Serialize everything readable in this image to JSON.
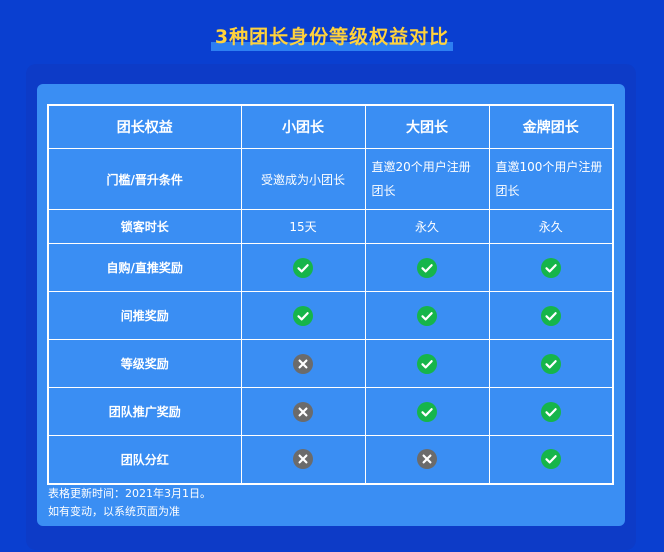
{
  "title": "3种团长身份等级权益对比",
  "headers": [
    "团长权益",
    "小团长",
    "大团长",
    "金牌团长"
  ],
  "rows": [
    {
      "label": "门槛/晋升条件",
      "cells": [
        "受邀成为小团长",
        "直邀20个用户注册团长",
        "直邀100个用户注册团长"
      ]
    },
    {
      "label": "锁客时长",
      "cells": [
        "15天",
        "永久",
        "永久"
      ]
    },
    {
      "label": "自购/直推奖励",
      "icons": [
        "check",
        "check",
        "check"
      ]
    },
    {
      "label": "间推奖励",
      "icons": [
        "check",
        "check",
        "check"
      ]
    },
    {
      "label": "等级奖励",
      "icons": [
        "cross",
        "check",
        "check"
      ]
    },
    {
      "label": "团队推广奖励",
      "icons": [
        "cross",
        "check",
        "check"
      ]
    },
    {
      "label": "团队分红",
      "icons": [
        "cross",
        "cross",
        "check"
      ]
    }
  ],
  "notes": [
    "表格更新时间：2021年3月1日。",
    "如有变动，以系统页面为准"
  ],
  "colors": {
    "check": "#16b54a",
    "cross": "#6b6b6b",
    "title": "#ffd23c"
  }
}
